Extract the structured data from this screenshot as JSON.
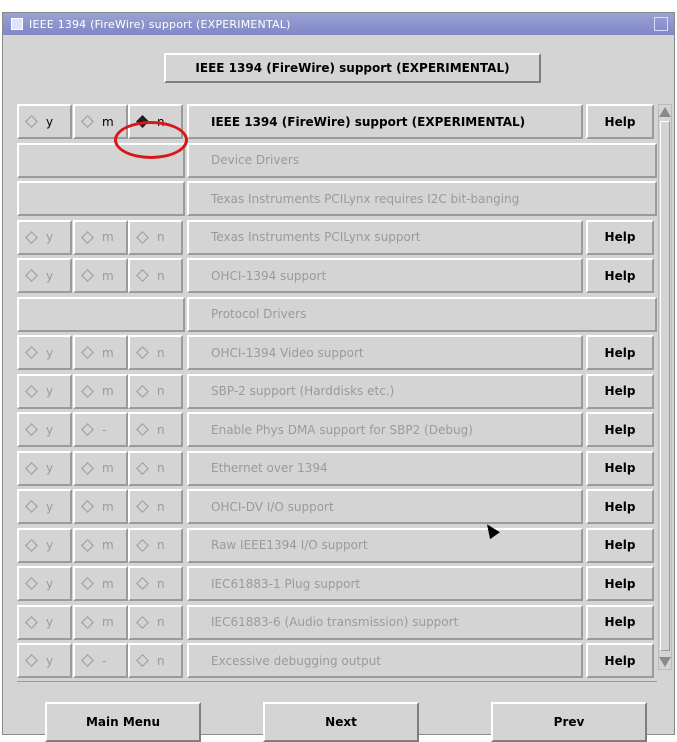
{
  "window": {
    "title": "IEEE 1394 (FireWire) support (EXPERIMENTAL)"
  },
  "header_button": {
    "label": "IEEE 1394 (FireWire) support (EXPERIMENTAL)"
  },
  "options_labels": {
    "y": "y",
    "m": "m",
    "n": "n",
    "dash": "-"
  },
  "help_label": "Help",
  "rows": [
    {
      "label": "IEEE 1394 (FireWire) support (EXPERIMENTAL)",
      "selected": "n",
      "active": true,
      "m_label": "m"
    },
    {
      "menu": true,
      "label": "Device Drivers"
    },
    {
      "menu": true,
      "label": "Texas Instruments PCILynx requires I2C bit-banging"
    },
    {
      "label": "Texas Instruments PCILynx support",
      "selected": "",
      "active": false,
      "m_label": "m"
    },
    {
      "label": "OHCI-1394 support",
      "selected": "",
      "active": false,
      "m_label": "m"
    },
    {
      "menu": true,
      "label": "Protocol Drivers"
    },
    {
      "label": "OHCI-1394 Video support",
      "selected": "",
      "active": false,
      "m_label": "m"
    },
    {
      "label": "SBP-2 support (Harddisks etc.)",
      "selected": "",
      "active": false,
      "m_label": "m"
    },
    {
      "label": "Enable Phys DMA support for SBP2 (Debug)",
      "selected": "",
      "active": false,
      "m_label": "-"
    },
    {
      "label": "Ethernet over 1394",
      "selected": "",
      "active": false,
      "m_label": "m"
    },
    {
      "label": "OHCI-DV I/O support",
      "selected": "",
      "active": false,
      "m_label": "m"
    },
    {
      "label": "Raw IEEE1394 I/O support",
      "selected": "",
      "active": false,
      "m_label": "m"
    },
    {
      "label": "IEC61883-1 Plug support",
      "selected": "",
      "active": false,
      "m_label": "m"
    },
    {
      "label": "IEC61883-6 (Audio transmission) support",
      "selected": "",
      "active": false,
      "m_label": "m"
    },
    {
      "label": "Excessive debugging output",
      "selected": "",
      "active": false,
      "m_label": "-"
    }
  ],
  "footer": {
    "main_menu": "Main Menu",
    "next": "Next",
    "prev": "Prev"
  }
}
